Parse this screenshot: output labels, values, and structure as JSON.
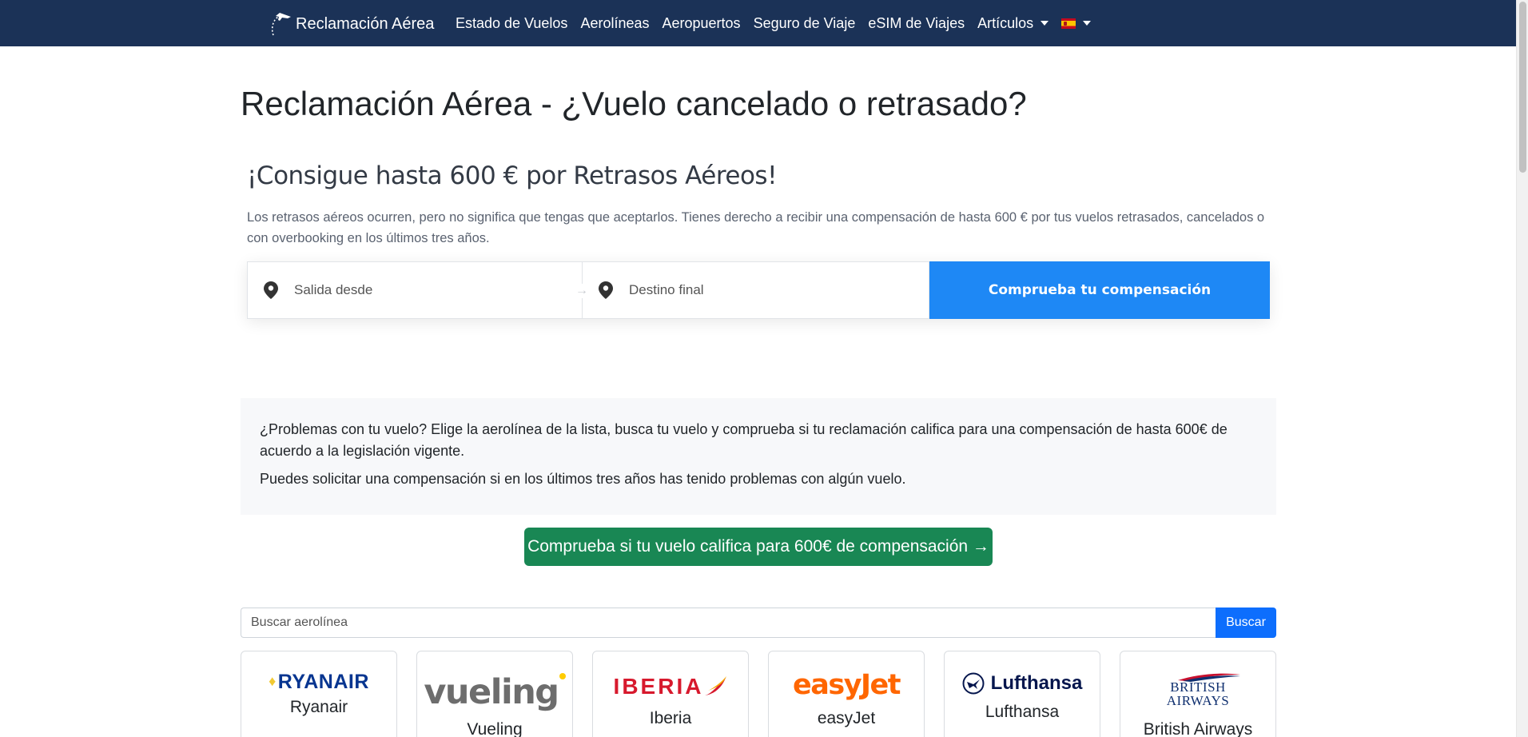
{
  "nav": {
    "brand": "Reclamación Aérea",
    "items": [
      "Estado de Vuelos",
      "Aerolíneas",
      "Aeropuertos",
      "Seguro de Viaje",
      "eSIM de Viajes"
    ],
    "articles": "Artículos",
    "language_flag": "spain-flag-icon"
  },
  "page": {
    "title": "Reclamación Aérea - ¿Vuelo cancelado o retrasado?"
  },
  "hero": {
    "title": "¡Consigue hasta 600 € por Retrasos Aéreos!",
    "text": "Los retrasos aéreos ocurren, pero no significa que tengas que aceptarlos. Tienes derecho a recibir una compensación de hasta 600 € por tus vuelos retrasados, cancelados o con overbooking en los últimos tres años."
  },
  "widget": {
    "from_placeholder": "Salida desde",
    "to_placeholder": "Destino final",
    "button": "Comprueba tu compensación",
    "from_value": "",
    "to_value": ""
  },
  "info": {
    "p1": "¿Problemas con tu vuelo? Elige la aerolínea de la lista, busca tu vuelo y comprueba si tu reclamación califica para una compensación de hasta 600€ de acuerdo a la legislación vigente.",
    "p2": "Puedes solicitar una compensación si en los últimos tres años has tenido problemas con algún vuelo."
  },
  "cta": {
    "label": "Comprueba si tu vuelo califica para 600€ de compensación →"
  },
  "airline_search": {
    "placeholder": "Buscar aerolínea",
    "value": "",
    "button": "Buscar"
  },
  "airlines": [
    {
      "name": "Ryanair",
      "logo_text": "RYANAIR"
    },
    {
      "name": "Vueling",
      "logo_text": "vueling"
    },
    {
      "name": "Iberia",
      "logo_text": "IBERIA"
    },
    {
      "name": "easyJet",
      "logo_text": "easyJet"
    },
    {
      "name": "Lufthansa",
      "logo_text": "Lufthansa"
    },
    {
      "name": "British Airways",
      "logo_text_1": "BRITISH",
      "logo_text_2": "AIRWAYS"
    }
  ],
  "colors": {
    "navbar": "#1b3257",
    "primary": "#1e88f5",
    "success": "#198754"
  }
}
